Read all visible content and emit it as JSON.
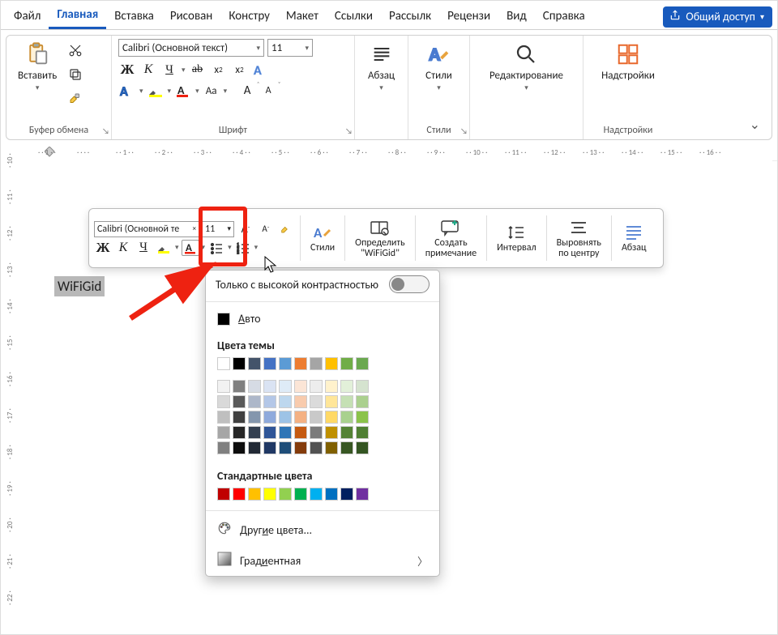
{
  "tabs": {
    "items": [
      "Файл",
      "Главная",
      "Вставка",
      "Рисован",
      "Констру",
      "Макет",
      "Ссылки",
      "Рассылк",
      "Рецензи",
      "Вид",
      "Справка"
    ],
    "active_index": 1
  },
  "share_button": "Общий доступ",
  "ribbon": {
    "clipboard": {
      "paste": "Вставить",
      "label": "Буфер обмена"
    },
    "font": {
      "name": "Calibri (Основной текст)",
      "size": "11",
      "bold": "Ж",
      "italic": "К",
      "underline": "Ч",
      "strike": "ab",
      "sub": "x₂",
      "sup": "x²",
      "case": "Aa",
      "grow": "A",
      "shrink": "A",
      "label": "Шрифт"
    },
    "paragraph": {
      "label": "Абзац"
    },
    "styles": {
      "btn": "Стили",
      "label": "Стили"
    },
    "editing": {
      "btn": "Редактирование"
    },
    "addins": {
      "btn": "Надстройки",
      "label": "Надстройки"
    }
  },
  "ruler": {
    "horizontal": [
      "1",
      "",
      "1",
      "2",
      "3",
      "4",
      "5",
      "6",
      "7",
      "8",
      "9",
      "10",
      "11",
      "12",
      "13",
      "14",
      "15",
      "16"
    ],
    "vertical": [
      "10",
      "11",
      "12",
      "13",
      "14",
      "15",
      "16",
      "17",
      "18",
      "19",
      "20",
      "21",
      "22"
    ]
  },
  "document": {
    "selected_text": "WiFiGid"
  },
  "mini": {
    "font_name": "Calibri (Основной те",
    "font_size": "11",
    "bold": "Ж",
    "italic": "К",
    "underline": "Ч",
    "styles": "Стили",
    "define": "Определить",
    "define_q": "\"WiFiGid\"",
    "comment1": "Создать",
    "comment2": "примечание",
    "interval": "Интервал",
    "alignc1": "Выровнять",
    "alignc2": "по центру",
    "para": "Абзац"
  },
  "panel": {
    "high_contrast": "Только с высокой контрастностью",
    "auto_underlined_letter": "А",
    "auto_rest": "вто",
    "theme_header": "Цвета темы",
    "theme_row": [
      "#ffffff",
      "#000000",
      "#44546a",
      "#4472c4",
      "#5b9bd5",
      "#ed7d31",
      "#a5a5a5",
      "#ffc000",
      "#70ad47",
      "#6aa84f"
    ],
    "shade_cols": [
      [
        "#f2f2f2",
        "#d9d9d9",
        "#bfbfbf",
        "#a6a6a6",
        "#808080"
      ],
      [
        "#7f7f7f",
        "#595959",
        "#404040",
        "#262626",
        "#0d0d0d"
      ],
      [
        "#d6dbe4",
        "#adb7c9",
        "#8496ad",
        "#333f50",
        "#222a35"
      ],
      [
        "#dae3f3",
        "#b4c7e7",
        "#8faadc",
        "#2f5597",
        "#203864"
      ],
      [
        "#deebf7",
        "#bdd7ee",
        "#9dc3e6",
        "#2e75b6",
        "#1f4e79"
      ],
      [
        "#fbe5d6",
        "#f8cbad",
        "#f4b183",
        "#c55a11",
        "#843c0c"
      ],
      [
        "#ededed",
        "#dbdbdb",
        "#c9c9c9",
        "#7b7b7b",
        "#525252"
      ],
      [
        "#fff2cc",
        "#ffe699",
        "#ffd966",
        "#bf9000",
        "#806000"
      ],
      [
        "#e2f0d9",
        "#c5e0b4",
        "#a9d18e",
        "#548235",
        "#385723"
      ],
      [
        "#d5e3cf",
        "#abd08f",
        "#8bc34a",
        "#4f7f33",
        "#345522"
      ]
    ],
    "standard_header": "Стандартные цвета",
    "standard_row": [
      "#c00000",
      "#ff0000",
      "#ffc000",
      "#ffff00",
      "#92d050",
      "#00b050",
      "#00b0f0",
      "#0070c0",
      "#002060",
      "#7030a0"
    ],
    "more_pre": "Друг",
    "more_u": "и",
    "more_post": "е цвета...",
    "grad_pre": "Град",
    "grad_u": "и",
    "grad_post": "ентная"
  }
}
